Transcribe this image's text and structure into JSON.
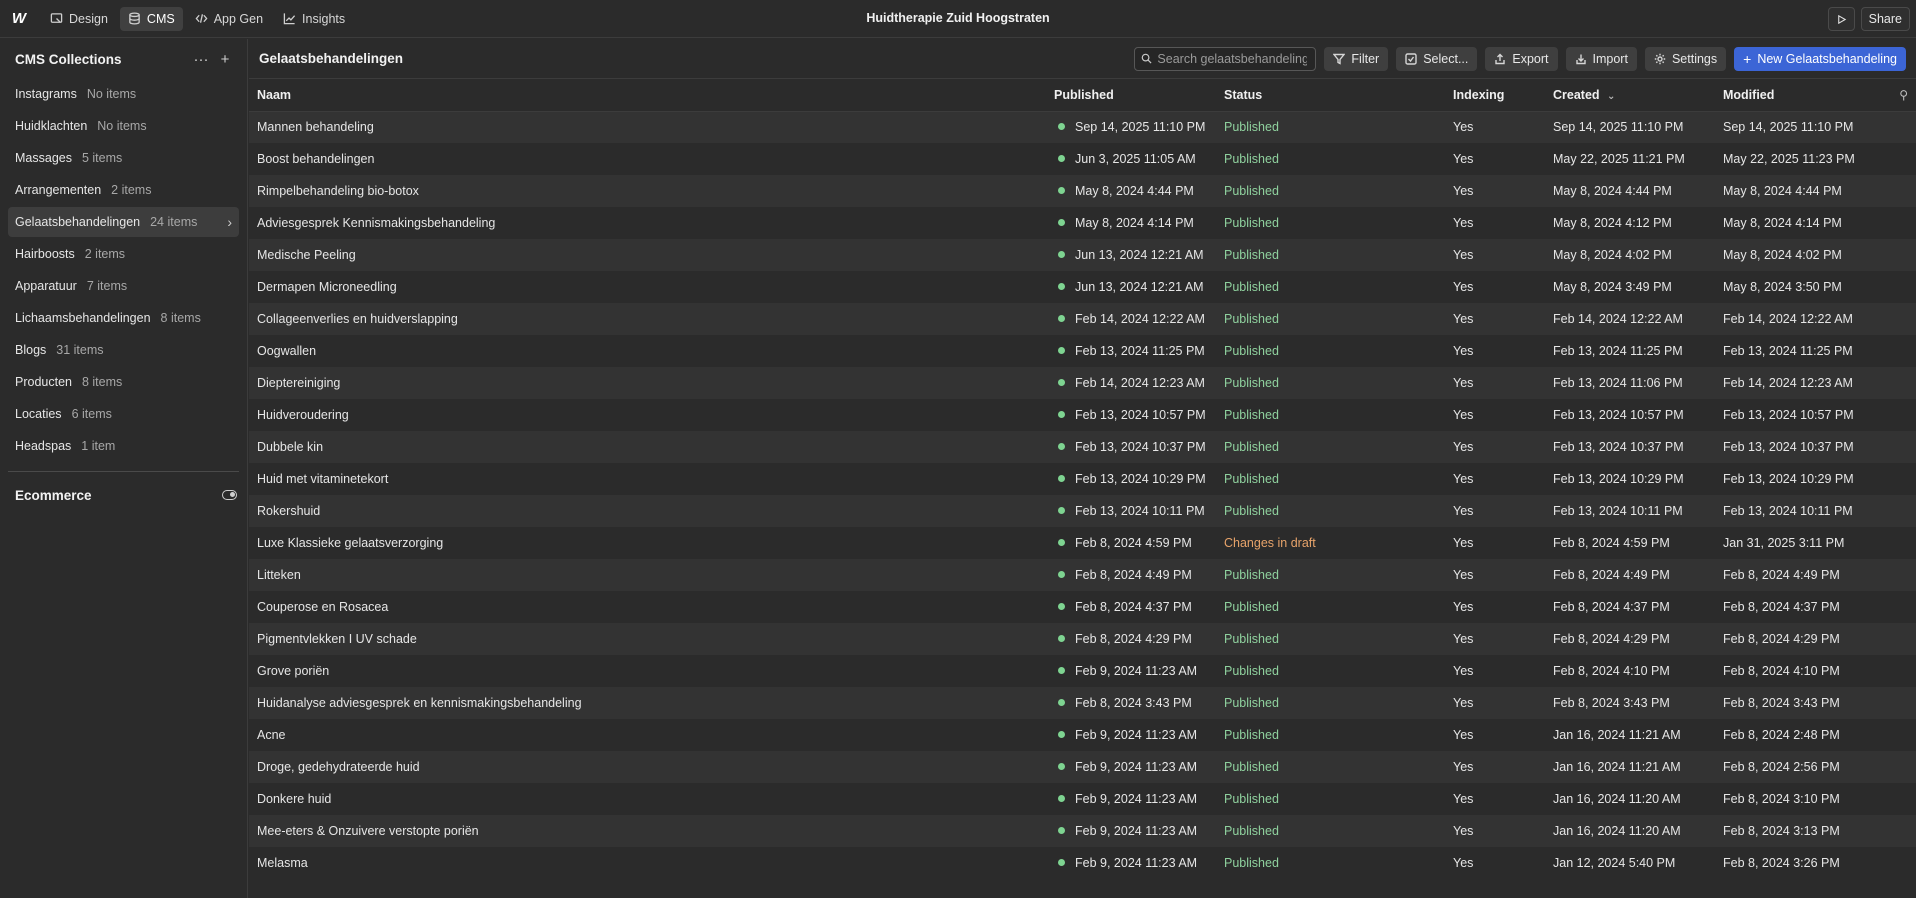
{
  "topbar": {
    "logo": "W",
    "nav": [
      {
        "label": "Design",
        "icon": "design-icon"
      },
      {
        "label": "CMS",
        "icon": "database-icon"
      },
      {
        "label": "App Gen",
        "icon": "code-icon"
      },
      {
        "label": "Insights",
        "icon": "chart-icon"
      }
    ],
    "site_title": "Huidtherapie Zuid Hoogstraten",
    "share_label": "Share"
  },
  "sidebar": {
    "title": "CMS Collections",
    "items": [
      {
        "label": "Instagrams",
        "count": "No items"
      },
      {
        "label": "Huidklachten",
        "count": "No items"
      },
      {
        "label": "Massages",
        "count": "5 items"
      },
      {
        "label": "Arrangementen",
        "count": "2 items"
      },
      {
        "label": "Gelaatsbehandelingen",
        "count": "24 items"
      },
      {
        "label": "Hairboosts",
        "count": "2 items"
      },
      {
        "label": "Apparatuur",
        "count": "7 items"
      },
      {
        "label": "Lichaamsbehandelingen",
        "count": "8 items"
      },
      {
        "label": "Blogs",
        "count": "31 items"
      },
      {
        "label": "Producten",
        "count": "8 items"
      },
      {
        "label": "Locaties",
        "count": "6 items"
      },
      {
        "label": "Headspas",
        "count": "1 item"
      }
    ],
    "ecommerce_label": "Ecommerce"
  },
  "main": {
    "title": "Gelaatsbehandelingen",
    "search_placeholder": "Search gelaatsbehandelingen",
    "filter_label": "Filter",
    "select_label": "Select...",
    "export_label": "Export",
    "import_label": "Import",
    "settings_label": "Settings",
    "new_label": "New Gelaatsbehandeling",
    "columns": [
      "Naam",
      "Published",
      "Status",
      "Indexing",
      "Created",
      "Modified"
    ],
    "rows": [
      [
        "Mannen behandeling",
        "Sep 14, 2025 11:10 PM",
        "Published",
        "Yes",
        "Sep 14, 2025 11:10 PM",
        "Sep 14, 2025 11:10 PM"
      ],
      [
        "Boost behandelingen",
        "Jun 3, 2025 11:05 AM",
        "Published",
        "Yes",
        "May 22, 2025 11:21 PM",
        "May 22, 2025 11:23 PM"
      ],
      [
        "Rimpelbehandeling bio-botox",
        "May 8, 2024 4:44 PM",
        "Published",
        "Yes",
        "May 8, 2024 4:44 PM",
        "May 8, 2024 4:44 PM"
      ],
      [
        "Adviesgesprek Kennismakingsbehandeling",
        "May 8, 2024 4:14 PM",
        "Published",
        "Yes",
        "May 8, 2024 4:12 PM",
        "May 8, 2024 4:14 PM"
      ],
      [
        "Medische Peeling",
        "Jun 13, 2024 12:21 AM",
        "Published",
        "Yes",
        "May 8, 2024 4:02 PM",
        "May 8, 2024 4:02 PM"
      ],
      [
        "Dermapen Microneedling",
        "Jun 13, 2024 12:21 AM",
        "Published",
        "Yes",
        "May 8, 2024 3:49 PM",
        "May 8, 2024 3:50 PM"
      ],
      [
        "Collageenverlies en huidverslapping",
        "Feb 14, 2024 12:22 AM",
        "Published",
        "Yes",
        "Feb 14, 2024 12:22 AM",
        "Feb 14, 2024 12:22 AM"
      ],
      [
        "Oogwallen",
        "Feb 13, 2024 11:25 PM",
        "Published",
        "Yes",
        "Feb 13, 2024 11:25 PM",
        "Feb 13, 2024 11:25 PM"
      ],
      [
        "Dieptereiniging",
        "Feb 14, 2024 12:23 AM",
        "Published",
        "Yes",
        "Feb 13, 2024 11:06 PM",
        "Feb 14, 2024 12:23 AM"
      ],
      [
        "Huidveroudering",
        "Feb 13, 2024 10:57 PM",
        "Published",
        "Yes",
        "Feb 13, 2024 10:57 PM",
        "Feb 13, 2024 10:57 PM"
      ],
      [
        "Dubbele kin",
        "Feb 13, 2024 10:37 PM",
        "Published",
        "Yes",
        "Feb 13, 2024 10:37 PM",
        "Feb 13, 2024 10:37 PM"
      ],
      [
        "Huid met vitaminetekort",
        "Feb 13, 2024 10:29 PM",
        "Published",
        "Yes",
        "Feb 13, 2024 10:29 PM",
        "Feb 13, 2024 10:29 PM"
      ],
      [
        "Rokershuid",
        "Feb 13, 2024 10:11 PM",
        "Published",
        "Yes",
        "Feb 13, 2024 10:11 PM",
        "Feb 13, 2024 10:11 PM"
      ],
      [
        "Luxe Klassieke gelaatsverzorging",
        "Feb 8, 2024 4:59 PM",
        "Changes in draft",
        "Yes",
        "Feb 8, 2024 4:59 PM",
        "Jan 31, 2025 3:11 PM"
      ],
      [
        "Litteken",
        "Feb 8, 2024 4:49 PM",
        "Published",
        "Yes",
        "Feb 8, 2024 4:49 PM",
        "Feb 8, 2024 4:49 PM"
      ],
      [
        "Couperose en Rosacea",
        "Feb 8, 2024 4:37 PM",
        "Published",
        "Yes",
        "Feb 8, 2024 4:37 PM",
        "Feb 8, 2024 4:37 PM"
      ],
      [
        "Pigmentvlekken I UV schade",
        "Feb 8, 2024 4:29 PM",
        "Published",
        "Yes",
        "Feb 8, 2024 4:29 PM",
        "Feb 8, 2024 4:29 PM"
      ],
      [
        "Grove poriën",
        "Feb 9, 2024 11:23 AM",
        "Published",
        "Yes",
        "Feb 8, 2024 4:10 PM",
        "Feb 8, 2024 4:10 PM"
      ],
      [
        "Huidanalyse adviesgesprek en kennismakingsbehandeling",
        "Feb 8, 2024 3:43 PM",
        "Published",
        "Yes",
        "Feb 8, 2024 3:43 PM",
        "Feb 8, 2024 3:43 PM"
      ],
      [
        "Acne",
        "Feb 9, 2024 11:23 AM",
        "Published",
        "Yes",
        "Jan 16, 2024 11:21 AM",
        "Feb 8, 2024 2:48 PM"
      ],
      [
        "Droge, gedehydrateerde huid",
        "Feb 9, 2024 11:23 AM",
        "Published",
        "Yes",
        "Jan 16, 2024 11:21 AM",
        "Feb 8, 2024 2:56 PM"
      ],
      [
        "Donkere huid",
        "Feb 9, 2024 11:23 AM",
        "Published",
        "Yes",
        "Jan 16, 2024 11:20 AM",
        "Feb 8, 2024 3:10 PM"
      ],
      [
        "Mee-eters & Onzuivere verstopte poriën",
        "Feb 9, 2024 11:23 AM",
        "Published",
        "Yes",
        "Jan 16, 2024 11:20 AM",
        "Feb 8, 2024 3:13 PM"
      ],
      [
        "Melasma",
        "Feb 9, 2024 11:23 AM",
        "Published",
        "Yes",
        "Jan 12, 2024 5:40 PM",
        "Feb 8, 2024 3:26 PM"
      ]
    ]
  },
  "colors": {
    "accent": "#3c65d6",
    "published": "#8fd19e",
    "draft": "#e7a36a",
    "dot": "#7ed491"
  }
}
